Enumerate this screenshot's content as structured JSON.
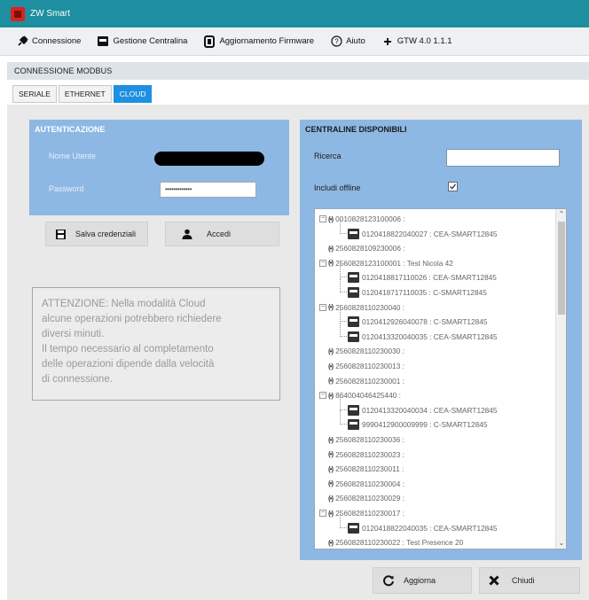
{
  "window": {
    "title": "ZW Smart"
  },
  "menu": {
    "items": [
      {
        "label": "Connessione",
        "icon": "plug-icon"
      },
      {
        "label": "Gestione Centralina",
        "icon": "device-icon"
      },
      {
        "label": "Aggiornamento Firmware",
        "icon": "firmware-icon"
      },
      {
        "label": "Aiuto",
        "icon": "help-icon"
      },
      {
        "label": "GTW 4.0 1.1.1",
        "icon": "plus-icon"
      }
    ]
  },
  "section": {
    "title": "CONNESSIONE MODBUS"
  },
  "tabs": [
    {
      "label": "SERIALE",
      "active": false
    },
    {
      "label": "ETHERNET",
      "active": false
    },
    {
      "label": "CLOUD",
      "active": true
    }
  ],
  "auth": {
    "title": "AUTENTICAZIONE",
    "username_label": "Nome Utente",
    "password_label": "Password",
    "password_value": "•••••••••••••"
  },
  "buttons": {
    "save_credentials": "Salva credenziali",
    "login": "Accedi",
    "refresh": "Aggiorna",
    "close": "Chiudi"
  },
  "warning": {
    "lines": [
      "ATTENZIONE: Nella modalità Cloud",
      "alcune operazioni potrebbero richiedere",
      "diversi minuti.",
      "Il tempo necessario al completamento",
      "delle operazioni dipende dalla velocità",
      "di connessione."
    ]
  },
  "available": {
    "title": "CENTRALINE DISPONIBILI",
    "search_label": "Ricerca",
    "search_value": "",
    "include_offline_label": "Includi offline",
    "include_offline_checked": true
  },
  "tree": [
    {
      "level": 0,
      "type": "gateway",
      "expander": "⊟",
      "label": "0010828123100006 :"
    },
    {
      "level": 1,
      "type": "device",
      "label": "0120418822040027 : CEA-SMART12845"
    },
    {
      "level": 0,
      "type": "gateway",
      "expander": "",
      "label": "2560828109230006 :"
    },
    {
      "level": 0,
      "type": "gateway",
      "expander": "⊟",
      "label": "2560828123100001 : Test Nicola 42"
    },
    {
      "level": 1,
      "type": "device",
      "label": "0120418817110026 : CEA-SMART12845"
    },
    {
      "level": 1,
      "type": "device",
      "label": "0120418717110035 : C-SMART12845"
    },
    {
      "level": 0,
      "type": "gateway",
      "expander": "⊟",
      "label": "2560828110230040 :"
    },
    {
      "level": 1,
      "type": "device",
      "label": "0120412926040078 : C-SMART12845"
    },
    {
      "level": 1,
      "type": "device",
      "label": "0120413320040035 : CEA-SMART12845"
    },
    {
      "level": 0,
      "type": "gateway",
      "expander": "",
      "label": "2560828110230030 :"
    },
    {
      "level": 0,
      "type": "gateway",
      "expander": "",
      "label": "2560828110230013 :"
    },
    {
      "level": 0,
      "type": "gateway",
      "expander": "",
      "label": "2560828110230001 :"
    },
    {
      "level": 0,
      "type": "gateway",
      "expander": "⊟",
      "label": "8640040464254​40 :"
    },
    {
      "level": 1,
      "type": "device",
      "label": "0120413320040034 : CEA-SMART12845"
    },
    {
      "level": 1,
      "type": "device",
      "label": "9990412900009999 : C-SMART12845"
    },
    {
      "level": 0,
      "type": "gateway",
      "expander": "",
      "label": "2560828110230036 :"
    },
    {
      "level": 0,
      "type": "gateway",
      "expander": "",
      "label": "2560828110230023 :"
    },
    {
      "level": 0,
      "type": "gateway",
      "expander": "",
      "label": "2560828110230011 :"
    },
    {
      "level": 0,
      "type": "gateway",
      "expander": "",
      "label": "2560828110230004 :"
    },
    {
      "level": 0,
      "type": "gateway",
      "expander": "",
      "label": "2560828110230029 :"
    },
    {
      "level": 0,
      "type": "gateway",
      "expander": "⊟",
      "label": "2560828110230017 :"
    },
    {
      "level": 1,
      "type": "device",
      "label": "0120418822040035 : CEA-SMART12845"
    },
    {
      "level": 0,
      "type": "gateway",
      "expander": "",
      "label": "2560828110230022 : Test Presence 20"
    }
  ]
}
